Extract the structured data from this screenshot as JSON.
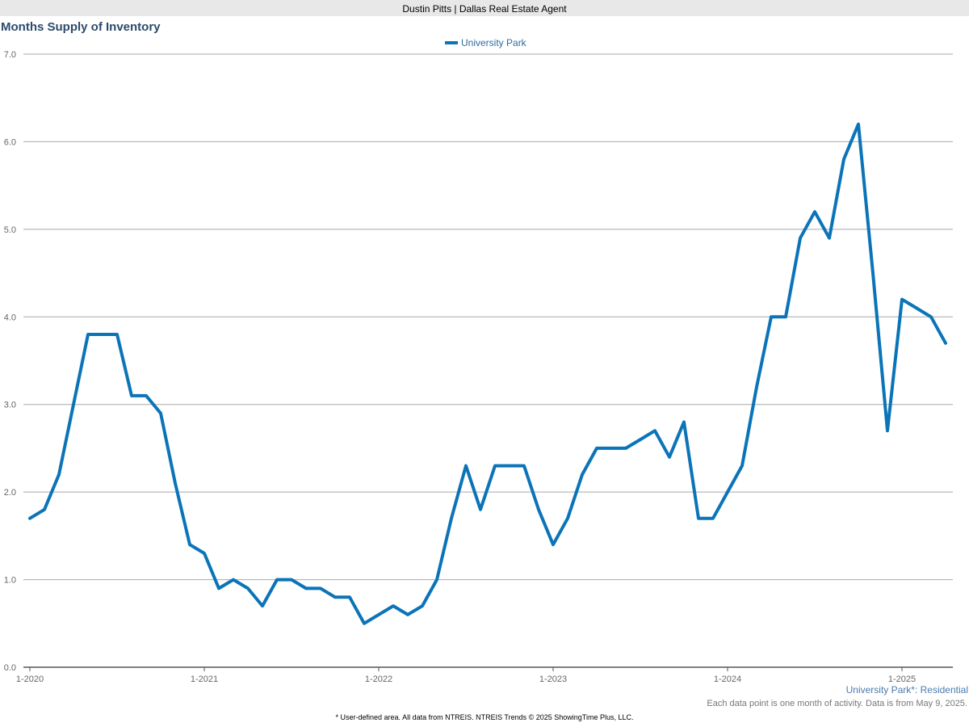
{
  "header": {
    "agent": "Dustin Pitts | Dallas Real Estate Agent"
  },
  "chart_data": {
    "type": "line",
    "title": "Months Supply of Inventory",
    "xlabel": "",
    "ylabel": "",
    "ylim": [
      0,
      7
    ],
    "yticks": [
      "0.0",
      "1.0",
      "2.0",
      "3.0",
      "4.0",
      "5.0",
      "6.0",
      "7.0"
    ],
    "xticks": [
      "1-2020",
      "1-2021",
      "1-2022",
      "1-2023",
      "1-2024",
      "1-2025"
    ],
    "grid": true,
    "legend_position": "top-center",
    "series": [
      {
        "name": "University Park",
        "color": "#0b74b8",
        "start": "1-2020",
        "values": [
          1.7,
          1.8,
          2.2,
          3.0,
          3.8,
          3.8,
          3.8,
          3.1,
          3.1,
          2.9,
          2.1,
          1.4,
          1.3,
          0.9,
          1.0,
          0.9,
          0.7,
          1.0,
          1.0,
          0.9,
          0.9,
          0.8,
          0.8,
          0.5,
          0.6,
          0.7,
          0.6,
          0.7,
          1.0,
          1.7,
          2.3,
          1.8,
          2.3,
          2.3,
          2.3,
          1.8,
          1.4,
          1.7,
          2.2,
          2.5,
          2.5,
          2.5,
          2.6,
          2.7,
          2.4,
          2.8,
          1.7,
          1.7,
          2.0,
          2.3,
          3.2,
          4.0,
          4.0,
          4.9,
          5.2,
          4.9,
          5.8,
          6.2,
          4.5,
          2.7,
          4.2,
          4.1,
          4.0,
          3.7
        ]
      }
    ]
  },
  "area_label": "University Park*: Residential",
  "note": "Each data point is one month of activity. Data is from May 9, 2025.",
  "footer": "* User-defined area. All data from NTREIS. NTREIS Trends © 2025 ShowingTime Plus, LLC."
}
